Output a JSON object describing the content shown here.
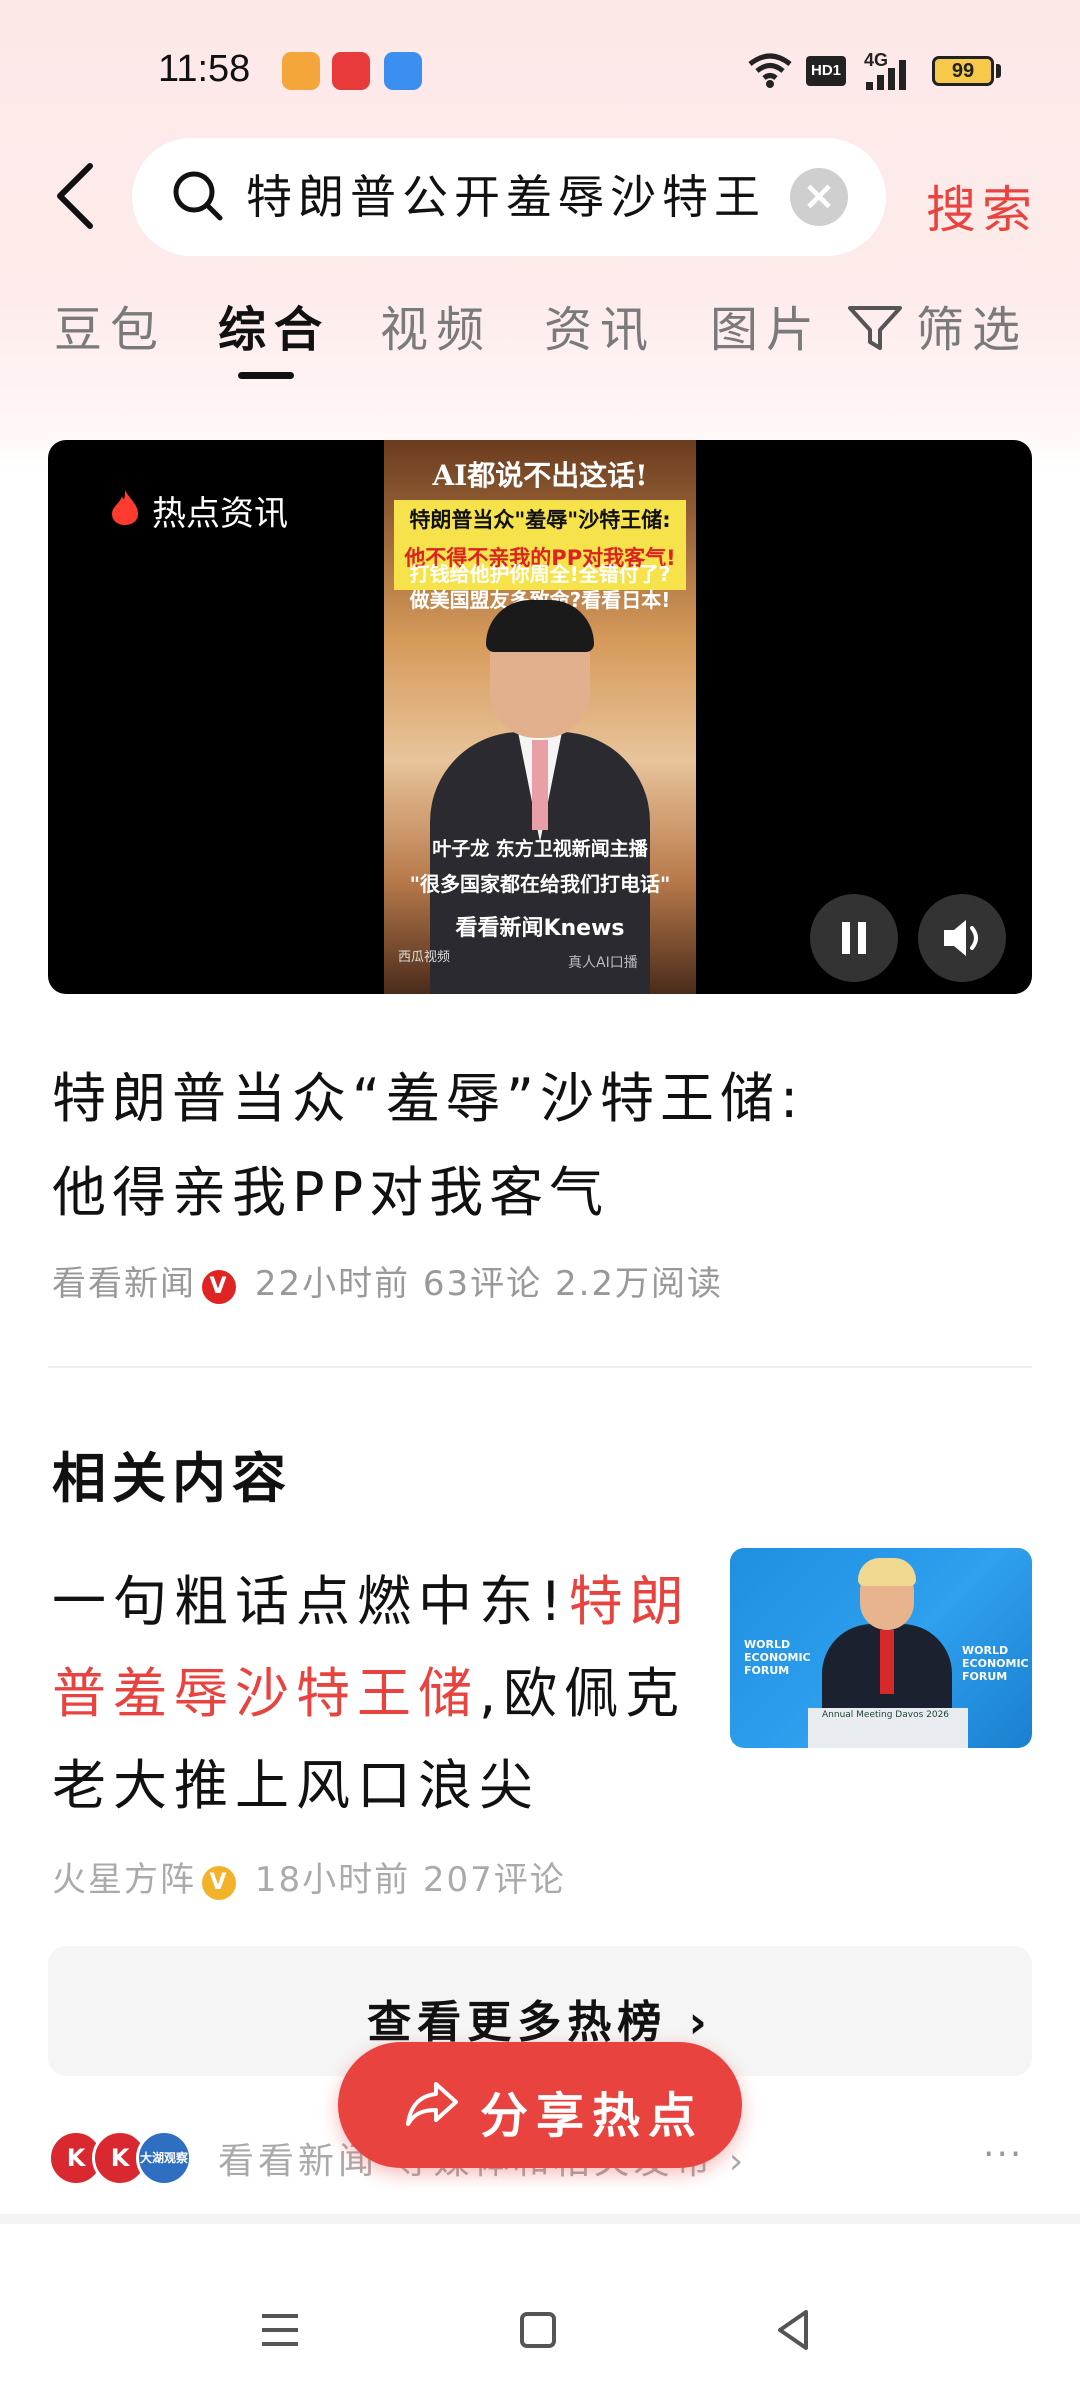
{
  "status_bar": {
    "time": "11:58",
    "network": "4G",
    "hd_label": "HD1",
    "battery": "99"
  },
  "header": {
    "search_query": "特朗普公开羞辱沙特王",
    "search_button": "搜索"
  },
  "tabs": [
    {
      "label": "豆包",
      "active": false
    },
    {
      "label": "综合",
      "active": true
    },
    {
      "label": "视频",
      "active": false
    },
    {
      "label": "资讯",
      "active": false
    },
    {
      "label": "图片",
      "active": false
    },
    {
      "label": "筛选",
      "active": false
    }
  ],
  "video": {
    "source_label": "热点资讯",
    "frame": {
      "top_text": "AI都说不出这话!",
      "banner_line1": "特朗普当众\"羞辱\"沙特王储:",
      "banner_line2": "他不得不亲我的PP对我客气!",
      "sub_line1": "打钱给他护你周全!全错付了?",
      "sub_line2": "做美国盟友多致命?看看日本!",
      "caption_line1": "叶子龙 东方卫视新闻主播",
      "caption_line2": "\"很多国家都在给我们打电话\"",
      "brand": "看看新闻Knews",
      "watermark_left": "西瓜视频",
      "watermark_right": "真人AI口播"
    }
  },
  "article": {
    "title_line1": "特朗普当众“羞辱”沙特王储:",
    "title_line2": "他得亲我PP对我客气",
    "source": "看看新闻",
    "time": "22小时前",
    "comments": "63评论",
    "reads": "2.2万阅读"
  },
  "related": {
    "section_title": "相关内容",
    "item": {
      "title_prefix": "一句粗话点燃中东!",
      "title_highlight": "特朗普羞辱沙特王储",
      "title_suffix": ",欧佩克老大推上风口浪尖",
      "source": "火星方阵",
      "time": "18小时前",
      "comments": "207评论",
      "thumb_text_left": "WORLD ECONOMIC FORUM",
      "thumb_text_right": "WORLD ECONOMIC FORUM",
      "thumb_podium_text": "Annual Meeting Davos 2026"
    }
  },
  "more_hot": {
    "label": "查看更多热榜 ›"
  },
  "source_row": {
    "avatar1": "K",
    "avatar2": "K",
    "avatar3": "大湖观察",
    "text": "看看新闻 等媒体和相关发布 ›",
    "more": "···"
  },
  "share": {
    "label": "分享热点"
  },
  "colors": {
    "accent": "#e8433f",
    "verified_red": "#e02323",
    "verified_gold": "#f2b32a"
  }
}
